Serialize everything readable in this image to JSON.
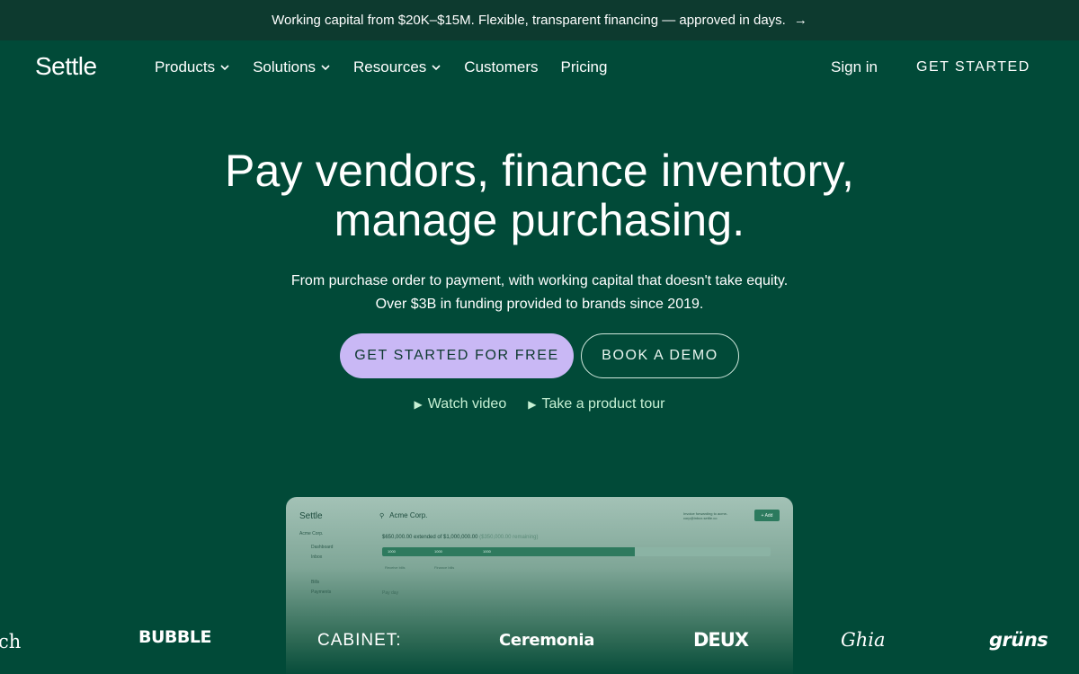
{
  "announcement": {
    "text": "Working capital from $20K–$15M. Flexible, transparent financing — approved in days.",
    "arrow_icon": "arrow-right-icon"
  },
  "nav": {
    "logo": "Settle",
    "links": [
      {
        "label": "Products",
        "has_dropdown": true
      },
      {
        "label": "Solutions",
        "has_dropdown": true
      },
      {
        "label": "Resources",
        "has_dropdown": true
      },
      {
        "label": "Customers",
        "has_dropdown": false
      },
      {
        "label": "Pricing",
        "has_dropdown": false
      }
    ],
    "sign_in": "Sign in",
    "get_started": "GET STARTED"
  },
  "hero": {
    "title_line1": "Pay vendors, finance inventory,",
    "title_line2": "manage purchasing.",
    "subtitle_line1": "From purchase order to payment, with working capital that doesn't take equity.",
    "subtitle_line2": "Over $3B in funding provided to brands since 2019.",
    "cta_primary": "GET STARTED FOR FREE",
    "cta_secondary": "BOOK A DEMO",
    "watch_video": "Watch video",
    "product_tour": "Take a product tour"
  },
  "preview": {
    "logo": "Settle",
    "company": "Acme Corp.",
    "sidebar_items": [
      "Acme Corp.",
      "Dashboard",
      "Inbox",
      "Bills",
      "Payments"
    ],
    "forward_text": "Invoice forwarding to acme-corp@inbox.settle.co",
    "add_label": "+ Add",
    "funding_text": "$650,000.00 extended of $1,000,000.00",
    "funding_remaining": "($350,000.00 remaining)",
    "funding_fraction": 0.65,
    "bar_labels": [
      "1000",
      "1000",
      "1000"
    ],
    "chips": [
      "Receive bills",
      "Finance bills"
    ],
    "section_label": "Pay day"
  },
  "customer_logos": [
    "ch",
    "BUBBLE",
    "CABINET:",
    "Ceremonia",
    "DEUX",
    "Ghia",
    "grüns"
  ],
  "colors": {
    "background": "#014a38",
    "announce_bg": "#0d3a2f",
    "cta_primary_bg": "#c9b8f5",
    "link_accent": "#c6f0d4"
  }
}
